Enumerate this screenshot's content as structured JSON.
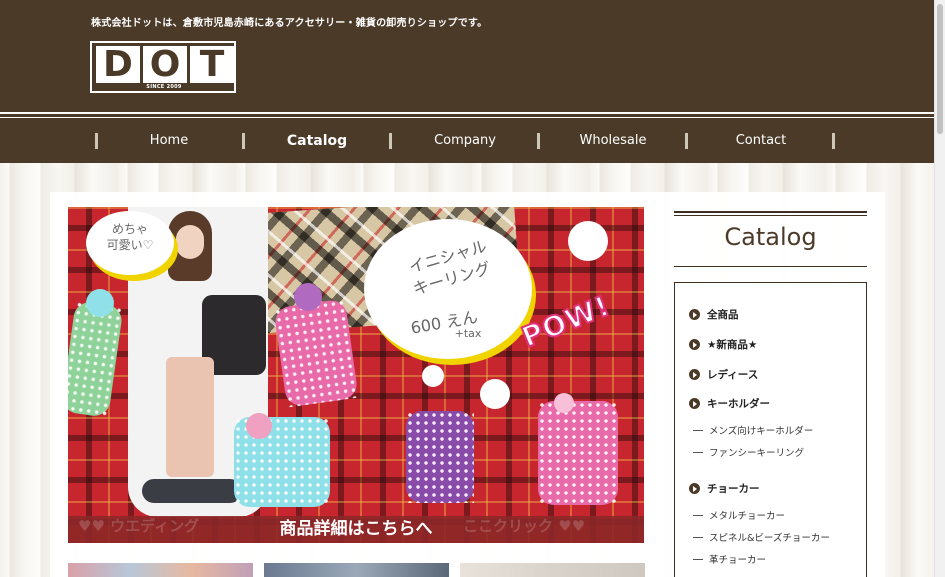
{
  "header": {
    "tagline": "株式会社ドットは、倉敷市児島赤崎にあるアクセサリー・雑貨の卸売りショップです。",
    "logo_text": "DOT",
    "logo_since": "SINCE 2009",
    "background_color": "#4b3a28"
  },
  "nav": {
    "items": [
      {
        "label": "Home"
      },
      {
        "label": "Catalog"
      },
      {
        "label": "Company"
      },
      {
        "label": "Wholesale"
      },
      {
        "label": "Contact"
      }
    ],
    "active": "Catalog"
  },
  "banner": {
    "bubble_left": "めちゃ\n可愛い♡",
    "cloud_line1": "イニシャル",
    "cloud_line2": "キーリング",
    "cloud_price": "600 えん",
    "cloud_tax": "+tax",
    "pow": "POW!",
    "strip_text": "商品詳細はこちらへ",
    "strip_faint_left": "♥♥ ウエディング",
    "strip_faint_right": "ここクリック ♥♥"
  },
  "sidebar": {
    "title": "Catalog",
    "categories": [
      {
        "label": "全商品"
      },
      {
        "label": "★新商品★"
      },
      {
        "label": "レディース"
      },
      {
        "label": "キーホルダー",
        "subs": [
          "メンズ向けキーホルダー",
          "ファンシーキーリング"
        ]
      },
      {
        "label": "チョーカー",
        "subs": [
          "メタルチョーカー",
          "スピネル&ビーズチョーカー",
          "革チョーカー"
        ]
      }
    ]
  },
  "colors": {
    "brand_brown": "#4b3a28",
    "banner_red": "#c8262e",
    "letter_pink": "#e86aa8",
    "letter_purple": "#8a4aa8",
    "letter_cyan": "#8fe0e8",
    "letter_green": "#8fd39a"
  }
}
